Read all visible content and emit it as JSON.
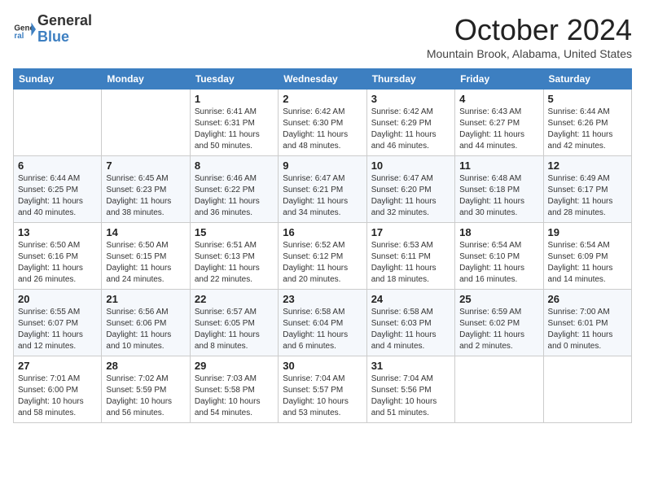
{
  "header": {
    "logo_line1": "General",
    "logo_line2": "Blue",
    "month": "October 2024",
    "location": "Mountain Brook, Alabama, United States"
  },
  "weekdays": [
    "Sunday",
    "Monday",
    "Tuesday",
    "Wednesday",
    "Thursday",
    "Friday",
    "Saturday"
  ],
  "weeks": [
    [
      {
        "day": "",
        "info": ""
      },
      {
        "day": "",
        "info": ""
      },
      {
        "day": "1",
        "info": "Sunrise: 6:41 AM\nSunset: 6:31 PM\nDaylight: 11 hours\nand 50 minutes."
      },
      {
        "day": "2",
        "info": "Sunrise: 6:42 AM\nSunset: 6:30 PM\nDaylight: 11 hours\nand 48 minutes."
      },
      {
        "day": "3",
        "info": "Sunrise: 6:42 AM\nSunset: 6:29 PM\nDaylight: 11 hours\nand 46 minutes."
      },
      {
        "day": "4",
        "info": "Sunrise: 6:43 AM\nSunset: 6:27 PM\nDaylight: 11 hours\nand 44 minutes."
      },
      {
        "day": "5",
        "info": "Sunrise: 6:44 AM\nSunset: 6:26 PM\nDaylight: 11 hours\nand 42 minutes."
      }
    ],
    [
      {
        "day": "6",
        "info": "Sunrise: 6:44 AM\nSunset: 6:25 PM\nDaylight: 11 hours\nand 40 minutes."
      },
      {
        "day": "7",
        "info": "Sunrise: 6:45 AM\nSunset: 6:23 PM\nDaylight: 11 hours\nand 38 minutes."
      },
      {
        "day": "8",
        "info": "Sunrise: 6:46 AM\nSunset: 6:22 PM\nDaylight: 11 hours\nand 36 minutes."
      },
      {
        "day": "9",
        "info": "Sunrise: 6:47 AM\nSunset: 6:21 PM\nDaylight: 11 hours\nand 34 minutes."
      },
      {
        "day": "10",
        "info": "Sunrise: 6:47 AM\nSunset: 6:20 PM\nDaylight: 11 hours\nand 32 minutes."
      },
      {
        "day": "11",
        "info": "Sunrise: 6:48 AM\nSunset: 6:18 PM\nDaylight: 11 hours\nand 30 minutes."
      },
      {
        "day": "12",
        "info": "Sunrise: 6:49 AM\nSunset: 6:17 PM\nDaylight: 11 hours\nand 28 minutes."
      }
    ],
    [
      {
        "day": "13",
        "info": "Sunrise: 6:50 AM\nSunset: 6:16 PM\nDaylight: 11 hours\nand 26 minutes."
      },
      {
        "day": "14",
        "info": "Sunrise: 6:50 AM\nSunset: 6:15 PM\nDaylight: 11 hours\nand 24 minutes."
      },
      {
        "day": "15",
        "info": "Sunrise: 6:51 AM\nSunset: 6:13 PM\nDaylight: 11 hours\nand 22 minutes."
      },
      {
        "day": "16",
        "info": "Sunrise: 6:52 AM\nSunset: 6:12 PM\nDaylight: 11 hours\nand 20 minutes."
      },
      {
        "day": "17",
        "info": "Sunrise: 6:53 AM\nSunset: 6:11 PM\nDaylight: 11 hours\nand 18 minutes."
      },
      {
        "day": "18",
        "info": "Sunrise: 6:54 AM\nSunset: 6:10 PM\nDaylight: 11 hours\nand 16 minutes."
      },
      {
        "day": "19",
        "info": "Sunrise: 6:54 AM\nSunset: 6:09 PM\nDaylight: 11 hours\nand 14 minutes."
      }
    ],
    [
      {
        "day": "20",
        "info": "Sunrise: 6:55 AM\nSunset: 6:07 PM\nDaylight: 11 hours\nand 12 minutes."
      },
      {
        "day": "21",
        "info": "Sunrise: 6:56 AM\nSunset: 6:06 PM\nDaylight: 11 hours\nand 10 minutes."
      },
      {
        "day": "22",
        "info": "Sunrise: 6:57 AM\nSunset: 6:05 PM\nDaylight: 11 hours\nand 8 minutes."
      },
      {
        "day": "23",
        "info": "Sunrise: 6:58 AM\nSunset: 6:04 PM\nDaylight: 11 hours\nand 6 minutes."
      },
      {
        "day": "24",
        "info": "Sunrise: 6:58 AM\nSunset: 6:03 PM\nDaylight: 11 hours\nand 4 minutes."
      },
      {
        "day": "25",
        "info": "Sunrise: 6:59 AM\nSunset: 6:02 PM\nDaylight: 11 hours\nand 2 minutes."
      },
      {
        "day": "26",
        "info": "Sunrise: 7:00 AM\nSunset: 6:01 PM\nDaylight: 11 hours\nand 0 minutes."
      }
    ],
    [
      {
        "day": "27",
        "info": "Sunrise: 7:01 AM\nSunset: 6:00 PM\nDaylight: 10 hours\nand 58 minutes."
      },
      {
        "day": "28",
        "info": "Sunrise: 7:02 AM\nSunset: 5:59 PM\nDaylight: 10 hours\nand 56 minutes."
      },
      {
        "day": "29",
        "info": "Sunrise: 7:03 AM\nSunset: 5:58 PM\nDaylight: 10 hours\nand 54 minutes."
      },
      {
        "day": "30",
        "info": "Sunrise: 7:04 AM\nSunset: 5:57 PM\nDaylight: 10 hours\nand 53 minutes."
      },
      {
        "day": "31",
        "info": "Sunrise: 7:04 AM\nSunset: 5:56 PM\nDaylight: 10 hours\nand 51 minutes."
      },
      {
        "day": "",
        "info": ""
      },
      {
        "day": "",
        "info": ""
      }
    ]
  ]
}
